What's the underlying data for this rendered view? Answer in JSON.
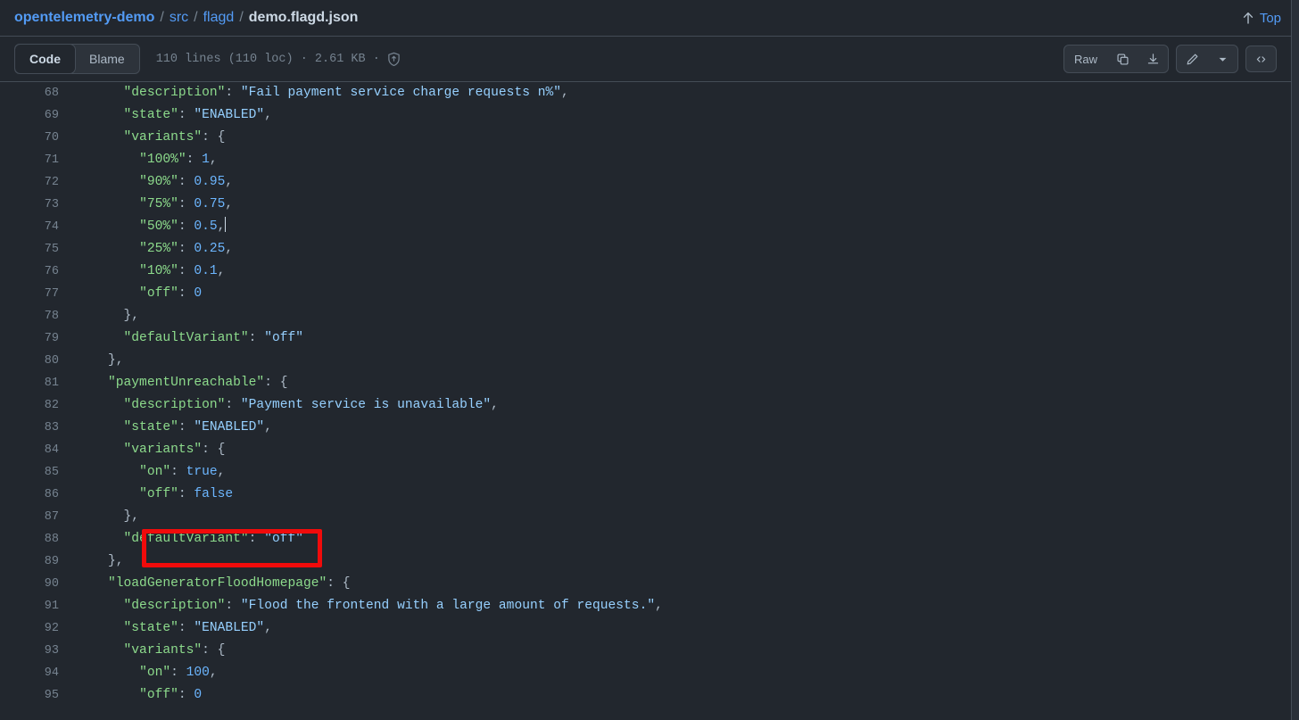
{
  "header": {
    "breadcrumb": {
      "repo": "opentelemetry-demo",
      "sep": "/",
      "dir1": "src",
      "dir2": "flagd",
      "file": "demo.flagd.json"
    },
    "top_link_label": "Top",
    "top_link_icon": "arrow-up-icon"
  },
  "toolbar": {
    "tabs": [
      {
        "label": "Code",
        "active": true
      },
      {
        "label": "Blame",
        "active": false
      }
    ],
    "file_stats": "110 lines (110 loc) · 2.61 KB ·",
    "shield_icon": "shield-check-icon",
    "raw_label": "Raw",
    "copy_icon": "copy-icon",
    "download_icon": "download-icon",
    "edit_icon": "pencil-icon",
    "edit_dropdown_icon": "chevron-down-icon",
    "symbols_icon": "code-brackets-icon"
  },
  "code": {
    "language": "json",
    "first_visible_line": 68,
    "lines": [
      {
        "num": "68",
        "indent": 6,
        "tokens": [
          {
            "t": "key",
            "v": "\"description\""
          },
          {
            "t": "punct",
            "v": ": "
          },
          {
            "t": "str",
            "v": "\"Fail payment service charge requests n%\""
          },
          {
            "t": "punct",
            "v": ","
          }
        ]
      },
      {
        "num": "69",
        "indent": 6,
        "tokens": [
          {
            "t": "key",
            "v": "\"state\""
          },
          {
            "t": "punct",
            "v": ": "
          },
          {
            "t": "str",
            "v": "\"ENABLED\""
          },
          {
            "t": "punct",
            "v": ","
          }
        ]
      },
      {
        "num": "70",
        "indent": 6,
        "tokens": [
          {
            "t": "key",
            "v": "\"variants\""
          },
          {
            "t": "punct",
            "v": ": {"
          }
        ]
      },
      {
        "num": "71",
        "indent": 8,
        "tokens": [
          {
            "t": "key",
            "v": "\"100%\""
          },
          {
            "t": "punct",
            "v": ": "
          },
          {
            "t": "num",
            "v": "1"
          },
          {
            "t": "punct",
            "v": ","
          }
        ]
      },
      {
        "num": "72",
        "indent": 8,
        "tokens": [
          {
            "t": "key",
            "v": "\"90%\""
          },
          {
            "t": "punct",
            "v": ": "
          },
          {
            "t": "num",
            "v": "0.95"
          },
          {
            "t": "punct",
            "v": ","
          }
        ]
      },
      {
        "num": "73",
        "indent": 8,
        "tokens": [
          {
            "t": "key",
            "v": "\"75%\""
          },
          {
            "t": "punct",
            "v": ": "
          },
          {
            "t": "num",
            "v": "0.75"
          },
          {
            "t": "punct",
            "v": ","
          }
        ]
      },
      {
        "num": "74",
        "indent": 8,
        "caret": true,
        "tokens": [
          {
            "t": "key",
            "v": "\"50%\""
          },
          {
            "t": "punct",
            "v": ": "
          },
          {
            "t": "num",
            "v": "0.5"
          },
          {
            "t": "punct",
            "v": ","
          }
        ]
      },
      {
        "num": "75",
        "indent": 8,
        "tokens": [
          {
            "t": "key",
            "v": "\"25%\""
          },
          {
            "t": "punct",
            "v": ": "
          },
          {
            "t": "num",
            "v": "0.25"
          },
          {
            "t": "punct",
            "v": ","
          }
        ]
      },
      {
        "num": "76",
        "indent": 8,
        "tokens": [
          {
            "t": "key",
            "v": "\"10%\""
          },
          {
            "t": "punct",
            "v": ": "
          },
          {
            "t": "num",
            "v": "0.1"
          },
          {
            "t": "punct",
            "v": ","
          }
        ]
      },
      {
        "num": "77",
        "indent": 8,
        "tokens": [
          {
            "t": "key",
            "v": "\"off\""
          },
          {
            "t": "punct",
            "v": ": "
          },
          {
            "t": "num",
            "v": "0"
          }
        ]
      },
      {
        "num": "78",
        "indent": 6,
        "tokens": [
          {
            "t": "punct",
            "v": "},"
          }
        ]
      },
      {
        "num": "79",
        "indent": 6,
        "tokens": [
          {
            "t": "key",
            "v": "\"defaultVariant\""
          },
          {
            "t": "punct",
            "v": ": "
          },
          {
            "t": "str",
            "v": "\"off\""
          }
        ]
      },
      {
        "num": "80",
        "indent": 4,
        "tokens": [
          {
            "t": "punct",
            "v": "},"
          }
        ]
      },
      {
        "num": "81",
        "indent": 4,
        "tokens": [
          {
            "t": "key",
            "v": "\"paymentUnreachable\""
          },
          {
            "t": "punct",
            "v": ": {"
          }
        ]
      },
      {
        "num": "82",
        "indent": 6,
        "tokens": [
          {
            "t": "key",
            "v": "\"description\""
          },
          {
            "t": "punct",
            "v": ": "
          },
          {
            "t": "str",
            "v": "\"Payment service is unavailable\""
          },
          {
            "t": "punct",
            "v": ","
          }
        ]
      },
      {
        "num": "83",
        "indent": 6,
        "tokens": [
          {
            "t": "key",
            "v": "\"state\""
          },
          {
            "t": "punct",
            "v": ": "
          },
          {
            "t": "str",
            "v": "\"ENABLED\""
          },
          {
            "t": "punct",
            "v": ","
          }
        ]
      },
      {
        "num": "84",
        "indent": 6,
        "tokens": [
          {
            "t": "key",
            "v": "\"variants\""
          },
          {
            "t": "punct",
            "v": ": {"
          }
        ]
      },
      {
        "num": "85",
        "indent": 8,
        "tokens": [
          {
            "t": "key",
            "v": "\"on\""
          },
          {
            "t": "punct",
            "v": ": "
          },
          {
            "t": "kw",
            "v": "true"
          },
          {
            "t": "punct",
            "v": ","
          }
        ]
      },
      {
        "num": "86",
        "indent": 8,
        "tokens": [
          {
            "t": "key",
            "v": "\"off\""
          },
          {
            "t": "punct",
            "v": ": "
          },
          {
            "t": "kw",
            "v": "false"
          }
        ]
      },
      {
        "num": "87",
        "indent": 6,
        "tokens": [
          {
            "t": "punct",
            "v": "},"
          }
        ]
      },
      {
        "num": "88",
        "indent": 6,
        "tokens": [
          {
            "t": "key",
            "v": "\"defaultVariant\""
          },
          {
            "t": "punct",
            "v": ": "
          },
          {
            "t": "str",
            "v": "\"off\""
          }
        ]
      },
      {
        "num": "89",
        "indent": 4,
        "tokens": [
          {
            "t": "punct",
            "v": "},"
          }
        ]
      },
      {
        "num": "90",
        "indent": 4,
        "tokens": [
          {
            "t": "key",
            "v": "\"loadGeneratorFloodHomepage\""
          },
          {
            "t": "punct",
            "v": ": {"
          }
        ]
      },
      {
        "num": "91",
        "indent": 6,
        "tokens": [
          {
            "t": "key",
            "v": "\"description\""
          },
          {
            "t": "punct",
            "v": ": "
          },
          {
            "t": "str",
            "v": "\"Flood the frontend with a large amount of requests.\""
          },
          {
            "t": "punct",
            "v": ","
          }
        ]
      },
      {
        "num": "92",
        "indent": 6,
        "tokens": [
          {
            "t": "key",
            "v": "\"state\""
          },
          {
            "t": "punct",
            "v": ": "
          },
          {
            "t": "str",
            "v": "\"ENABLED\""
          },
          {
            "t": "punct",
            "v": ","
          }
        ]
      },
      {
        "num": "93",
        "indent": 6,
        "tokens": [
          {
            "t": "key",
            "v": "\"variants\""
          },
          {
            "t": "punct",
            "v": ": {"
          }
        ]
      },
      {
        "num": "94",
        "indent": 8,
        "tokens": [
          {
            "t": "key",
            "v": "\"on\""
          },
          {
            "t": "punct",
            "v": ": "
          },
          {
            "t": "num",
            "v": "100"
          },
          {
            "t": "punct",
            "v": ","
          }
        ]
      },
      {
        "num": "95",
        "indent": 8,
        "tokens": [
          {
            "t": "key",
            "v": "\"off\""
          },
          {
            "t": "punct",
            "v": ": "
          },
          {
            "t": "num",
            "v": "0"
          }
        ]
      }
    ]
  },
  "annotation": {
    "type": "highlight-rectangle",
    "color": "#f10b0b",
    "target_line": "88",
    "target_text": "\"defaultVariant\": \"off\""
  },
  "colors": {
    "background": "#22272e",
    "border": "#444c56",
    "link": "#539bf5",
    "text": "#adbac7",
    "muted": "#768390",
    "syntax_key": "#8ddb8c",
    "syntax_string": "#96d0ff",
    "syntax_number": "#6cb6ff",
    "annotation_red": "#f10b0b"
  }
}
